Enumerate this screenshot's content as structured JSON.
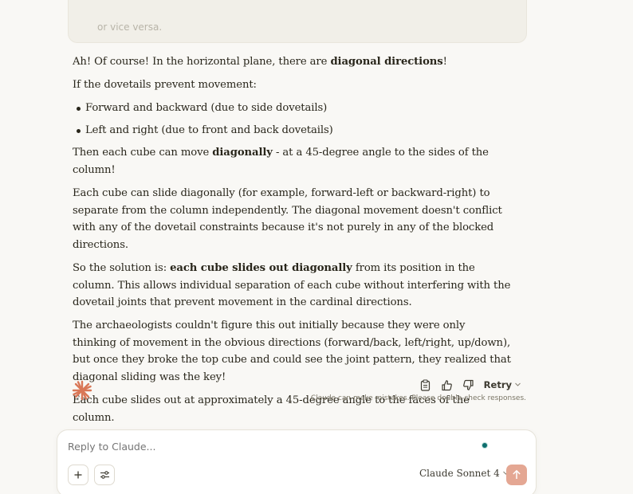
{
  "previous_message": {
    "faded_text": "or vice versa."
  },
  "message": {
    "p1_pre": "Ah! Of course! In the horizontal plane, there are ",
    "p1_bold": "diagonal directions",
    "p1_post": "!",
    "p2": "If the dovetails prevent movement:",
    "bullets": [
      "Forward and backward (due to side dovetails)",
      "Left and right (due to front and back dovetails)"
    ],
    "p3_pre": "Then each cube can move ",
    "p3_bold": "diagonally",
    "p3_post": " - at a 45-degree angle to the sides of the column!",
    "p4": "Each cube can slide diagonally (for example, forward-left or backward-right) to separate from the column independently. The diagonal movement doesn't conflict with any of the dovetail constraints because it's not purely in any of the blocked directions.",
    "p5_pre": "So the solution is: ",
    "p5_bold": "each cube slides out diagonally",
    "p5_post": " from its position in the column. This allows individual separation of each cube without interfering with the dovetail joints that prevent movement in the cardinal directions.",
    "p6": "The archaeologists couldn't figure this out initially because they were only thinking of movement in the obvious directions (forward/back, left/right, up/down), but once they broke the top cube and could see the joint pattern, they realized that diagonal sliding was the key!",
    "p7": "Each cube slides out at approximately a 45-degree angle to the faces of the column."
  },
  "actions": {
    "retry_label": "Retry",
    "disclaimer": "Claude can make mistakes. Please double-check responses."
  },
  "composer": {
    "placeholder": "Reply to Claude...",
    "model_label": "Claude Sonnet 4"
  },
  "colors": {
    "accent": "#d97757",
    "send_button": "#e4a793",
    "background": "#f9f8f5"
  },
  "icons": [
    "claude-logo-icon",
    "copy-icon",
    "thumbs-up-icon",
    "thumbs-down-icon",
    "chevron-down-icon",
    "plus-icon",
    "sliders-icon",
    "arrow-up-icon"
  ]
}
